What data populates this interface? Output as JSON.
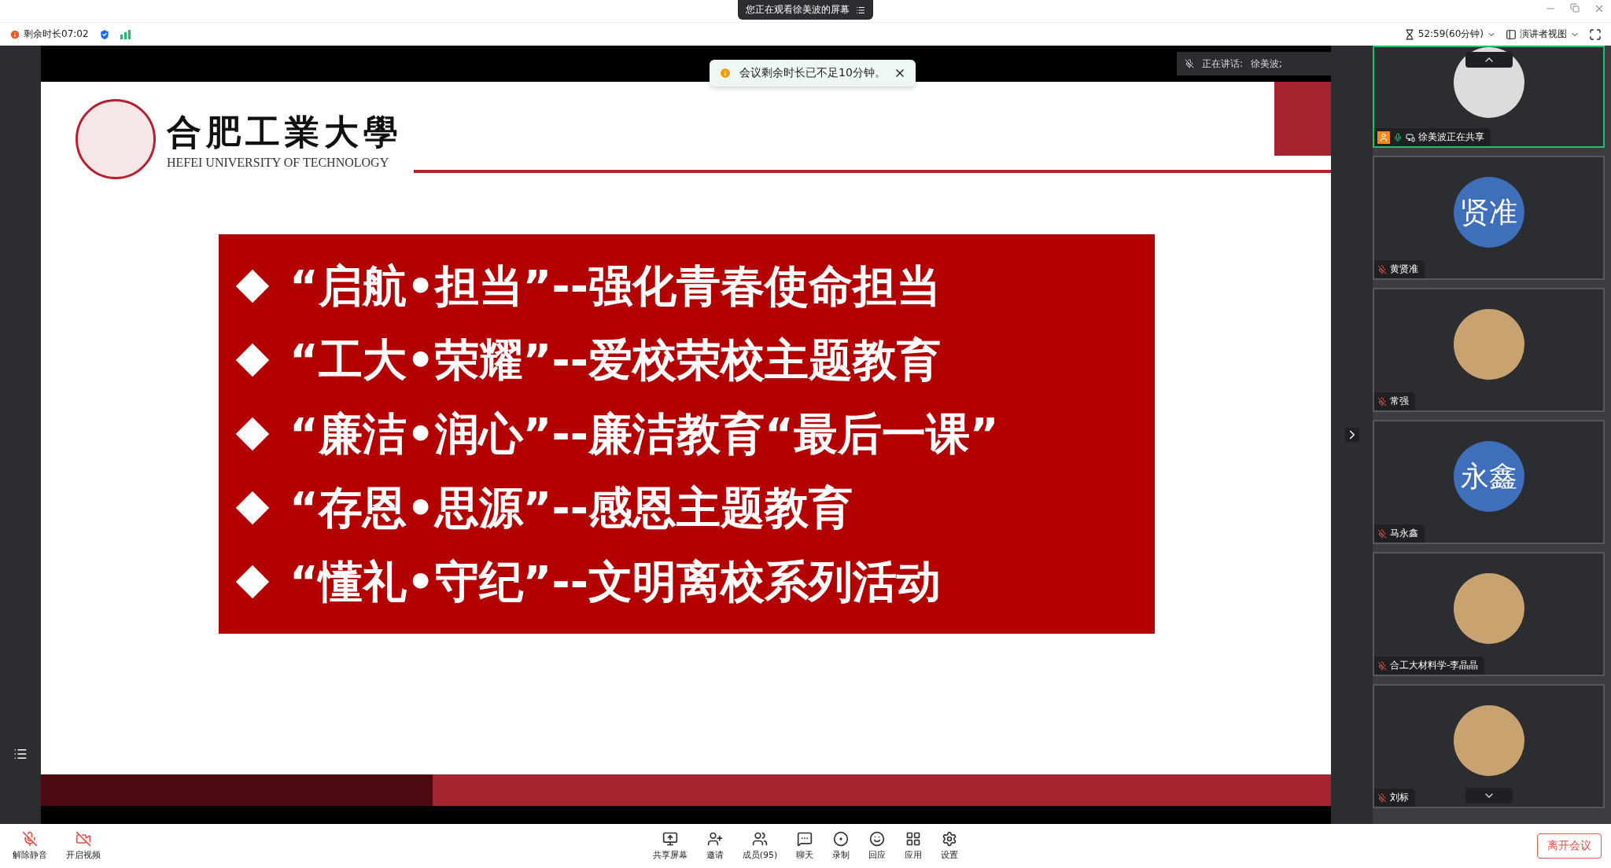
{
  "window": {
    "banner": "您正在观看徐美波的屏幕"
  },
  "info_bar": {
    "remaining": "剩余时长07:02",
    "timer": "52:59(60分钟)",
    "view": "演讲者视图"
  },
  "notice": {
    "text": "会议剩余时长已不足10分钟。"
  },
  "speaking": {
    "label": "正在讲话:",
    "name": "徐美波;"
  },
  "slide": {
    "school_name": "合肥工業大學",
    "school_name_en": "HEFEI UNIVERSITY OF TECHNOLOGY",
    "items": [
      "“启航•担当”--强化青春使命担当",
      "“工大•荣耀”--爱校荣校主题教育",
      "“廉洁•润心”--廉洁教育“最后一课”",
      "“存恩•思源”--感恩主题教育",
      "“懂礼•守纪”--文明离校系列活动"
    ]
  },
  "participants": [
    {
      "name": "徐美波正在共享",
      "kind": "default",
      "muted": false,
      "selected": true
    },
    {
      "name": "黄贤准",
      "kind": "initials",
      "initials": "贤准",
      "muted": true,
      "selected": false
    },
    {
      "name": "常强",
      "kind": "photo",
      "muted": true,
      "selected": false
    },
    {
      "name": "马永鑫",
      "kind": "initials",
      "initials": "永鑫",
      "muted": true,
      "selected": false
    },
    {
      "name": "合工大材料学-李晶晶",
      "kind": "photo",
      "muted": true,
      "selected": false
    },
    {
      "name": "刘标",
      "kind": "photo",
      "muted": true,
      "selected": false
    }
  ],
  "toolbar": {
    "left": [
      {
        "label": "解除静音",
        "kind": "mic"
      },
      {
        "label": "开启视频",
        "kind": "video"
      }
    ],
    "center": [
      {
        "label": "共享屏幕",
        "kind": "share"
      },
      {
        "label": "邀请",
        "kind": "invite"
      },
      {
        "label": "成员(95)",
        "kind": "members"
      },
      {
        "label": "聊天",
        "kind": "chat"
      },
      {
        "label": "录制",
        "kind": "record"
      },
      {
        "label": "回应",
        "kind": "react"
      },
      {
        "label": "应用",
        "kind": "apps"
      },
      {
        "label": "设置",
        "kind": "settings"
      }
    ],
    "leave": "离开会议"
  }
}
